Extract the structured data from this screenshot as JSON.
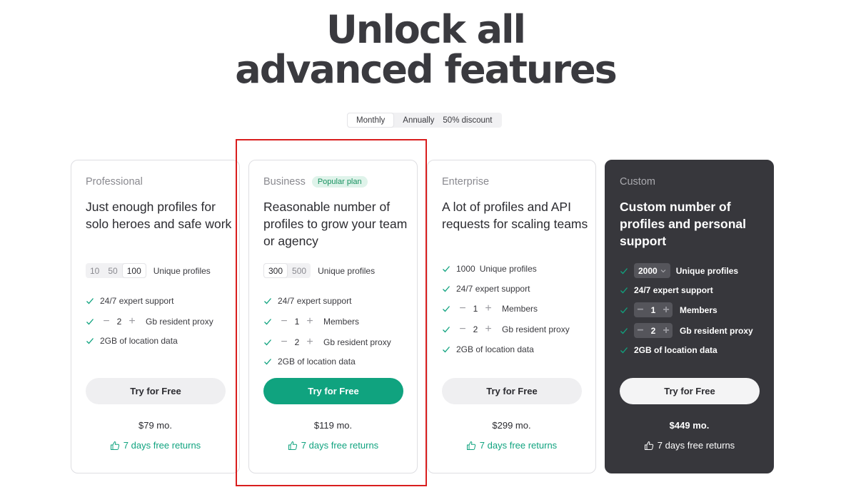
{
  "hero": {
    "line1": "Unlock all",
    "line2": "advanced features"
  },
  "billing": {
    "monthly": "Monthly",
    "annually": "Annually",
    "discount": "50% discount",
    "selected": "Monthly"
  },
  "common": {
    "unique_profiles": "Unique profiles",
    "support": "24/7 expert support",
    "members": "Members",
    "proxy": "Gb resident proxy",
    "location": "2GB of location data",
    "try_label": "Try for Free",
    "returns": "7 days free returns"
  },
  "plans": {
    "professional": {
      "name": "Professional",
      "description": "Just enough profiles for solo heroes and safe work",
      "profile_options": [
        "10",
        "50",
        "100"
      ],
      "profile_selected": "100",
      "proxy_value": "2",
      "price": "$79 mo."
    },
    "business": {
      "name": "Business",
      "badge": "Popular plan",
      "description": "Reasonable number of profiles to grow your team or agency",
      "profile_options": [
        "300",
        "500"
      ],
      "profile_selected": "300",
      "members_value": "1",
      "proxy_value": "2",
      "price": "$119 mo."
    },
    "enterprise": {
      "name": "Enterprise",
      "description": "A lot of profiles and API requests for scaling teams",
      "profiles_value": "1000",
      "members_value": "1",
      "proxy_value": "2",
      "price": "$299 mo."
    },
    "custom": {
      "name": "Custom",
      "description": "Custom number of profiles and personal support",
      "profiles_value": "2000",
      "members_value": "1",
      "proxy_value": "2",
      "price": "$449 mo."
    }
  },
  "colors": {
    "accent_green": "#10a37f",
    "dark_card": "#37373c",
    "highlight_red": "#d91e1e"
  }
}
